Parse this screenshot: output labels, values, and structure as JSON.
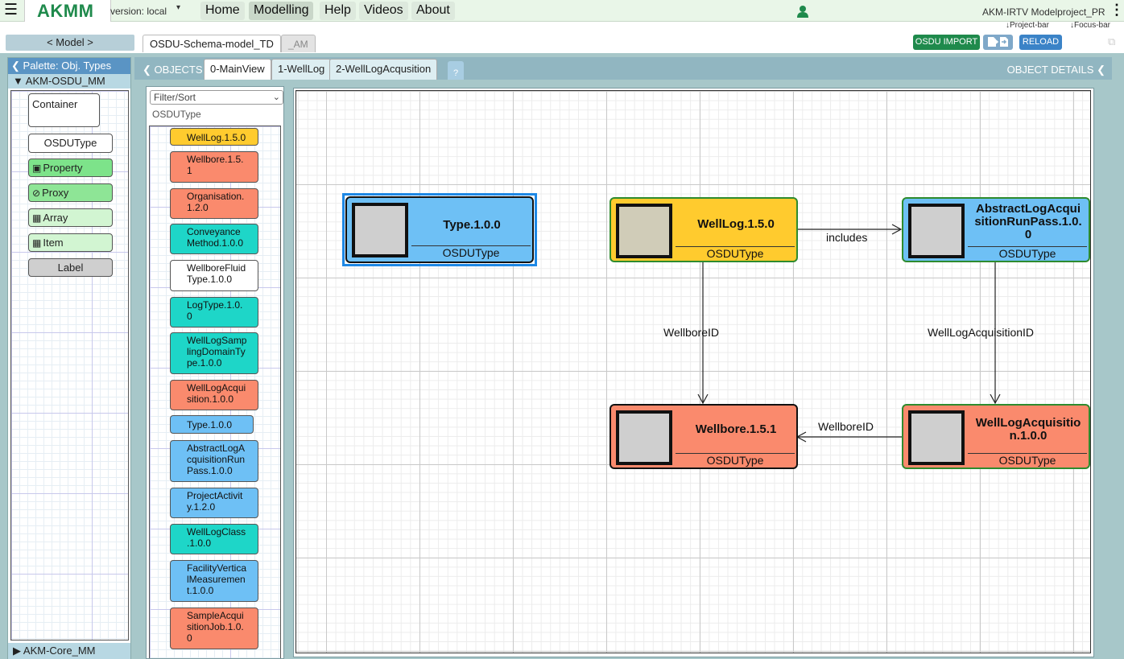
{
  "topbar": {
    "brand": "AKMM",
    "version": "version: local",
    "nav": [
      "Home",
      "Modelling",
      "Help",
      "Videos",
      "About"
    ],
    "project": "AKM-IRTV Modelproject_PR",
    "project_bar": "↓Project-bar",
    "focus_bar": "↓Focus-bar"
  },
  "modelbar": {
    "model_button": "< Model >",
    "tabs": [
      "OSDU-Schema-model_TD",
      "_AM"
    ],
    "osdu_import": "OSDU IMPORT",
    "reload": "RELOAD"
  },
  "palette": {
    "header": "Palette: Obj. Types",
    "metamodel": "AKM-OSDU_MM",
    "footer": "AKM-Core_MM",
    "items": [
      {
        "label": "Container",
        "bg": "#ffffff"
      },
      {
        "label": "OSDUType",
        "bg": "#ffffff"
      },
      {
        "label": "Property",
        "bg": "#7de38a",
        "icon": "property-icon"
      },
      {
        "label": "Proxy",
        "bg": "#8ee596",
        "icon": "proxy-icon"
      },
      {
        "label": "Array",
        "bg": "#d2f5d2",
        "icon": "array-icon"
      },
      {
        "label": "Item",
        "bg": "#d2f5d2",
        "icon": "item-icon"
      },
      {
        "label": "Label",
        "bg": "#cfcfcf"
      }
    ]
  },
  "main": {
    "objects_label": "OBJECTS",
    "details_label": "OBJECT DETAILS",
    "tabs": [
      "0-MainView",
      "1-WellLog",
      "2-WellLogAcqusition"
    ],
    "help": "?"
  },
  "objlist": {
    "filter": "Filter/Sort",
    "type": "OSDUType",
    "items": [
      {
        "label": "WellLog.1.5.0",
        "bg": "#ffcb2e"
      },
      {
        "label": "Wellbore.1.5.\n1",
        "bg": "#fa8a6d"
      },
      {
        "label": "Organisation.\n1.2.0",
        "bg": "#fa8a6d"
      },
      {
        "label": "Conveyance\nMethod.1.0.0",
        "bg": "#1ed6c8"
      },
      {
        "label": "WellboreFluid\nType.1.0.0",
        "bg": "#ffffff"
      },
      {
        "label": "LogType.1.0.\n0",
        "bg": "#1ed6c8"
      },
      {
        "label": "WellLogSamp\nlingDomainTy\npe.1.0.0",
        "bg": "#1ed6c8"
      },
      {
        "label": "WellLogAcqui\nsition.1.0.0",
        "bg": "#fa8a6d"
      },
      {
        "label": "Type.1.0.0",
        "bg": "#6ec0f5"
      },
      {
        "label": "AbstractLogA\ncquisitionRun\nPass.1.0.0",
        "bg": "#6ec0f5"
      },
      {
        "label": "ProjectActivit\ny.1.2.0",
        "bg": "#6ec0f5"
      },
      {
        "label": "WellLogClass\n.1.0.0",
        "bg": "#1ed6c8"
      },
      {
        "label": "FacilityVertica\nlMeasuremen\nt.1.0.0",
        "bg": "#6ec0f5"
      },
      {
        "label": "SampleAcqui\nsitionJob.1.0.\n0",
        "bg": "#fa8a6d"
      }
    ]
  },
  "diagram": {
    "nodes": [
      {
        "id": "type",
        "title": "Type.1.0.0",
        "type": "OSDUType",
        "bg": "#6ec0f5",
        "border": "#111111",
        "selected": true
      },
      {
        "id": "welllog",
        "title": "WellLog.1.5.0",
        "type": "OSDUType",
        "bg": "#ffcb2e",
        "border": "#2e8b2e"
      },
      {
        "id": "abstractlog",
        "title": "AbstractLogAcqui\nsitionRunPass.1.0.\n0",
        "type": "OSDUType",
        "bg": "#6ec0f5",
        "border": "#2e8b2e"
      },
      {
        "id": "wellbore",
        "title": "Wellbore.1.5.1",
        "type": "OSDUType",
        "bg": "#fa8a6d",
        "border": "#111111"
      },
      {
        "id": "welllogacq",
        "title": "WellLogAcquisitio\nn.1.0.0",
        "type": "OSDUType",
        "bg": "#fa8a6d",
        "border": "#2e8b2e"
      }
    ],
    "links": [
      {
        "from": "welllog",
        "to": "abstractlog",
        "label": "includes"
      },
      {
        "from": "welllog",
        "to": "wellbore",
        "label": "WellboreID"
      },
      {
        "from": "abstractlog",
        "to": "welllogacq",
        "label": "WellLogAcquisitionID"
      },
      {
        "from": "welllogacq",
        "to": "wellbore",
        "label": "WellboreID"
      }
    ]
  },
  "colors": {
    "brand": "#1f8a4c",
    "osdu_import": "#1f8a4c",
    "reload": "#3b83c7",
    "palette_header": "#5a94c4"
  }
}
